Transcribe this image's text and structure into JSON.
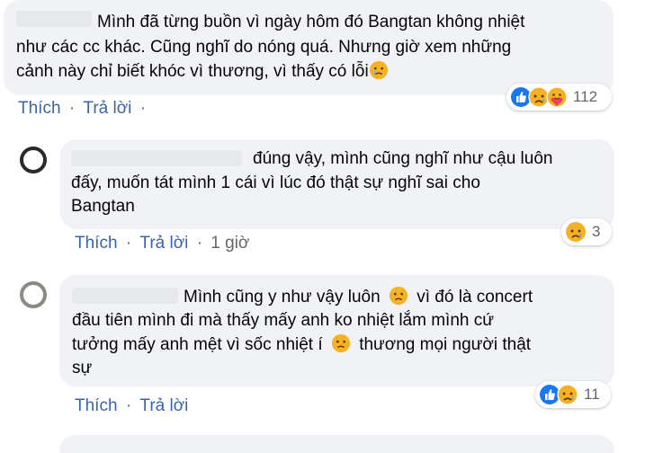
{
  "comments": [
    {
      "lines": [
        "Mình đã từng buồn vì ngày hôm đó Bangtan không nhiệt",
        "như các cc khác. Cũng nghĩ do nóng quá. Nhưng giờ xem những",
        "cảnh này chỉ biết khóc vì thương, vì thấy có lỗi"
      ],
      "like_label": "Thích",
      "reply_label": "Trả lời",
      "sep": "·",
      "reaction_count": "112"
    },
    {
      "lines": [
        "đúng vậy, mình cũng nghĩ như cậu luôn",
        "đấy, muốn tát mình 1 cái vì lúc đó thật sự nghĩ sai cho",
        "Bangtan"
      ],
      "like_label": "Thích",
      "reply_label": "Trả lời",
      "sep": "·",
      "time": "1 giờ",
      "reaction_count": "3"
    },
    {
      "line1_a": "Mình cũng y như vậy luôn",
      "line1_b": "vì đó là concert",
      "line2": "đầu tiên mình đi mà thấy mấy anh ko nhiệt lắm mình cứ",
      "line3_a": "tưởng mấy anh mệt vì sốc nhiệt í",
      "line3_b": "thương mọi người thật",
      "line4": "sự",
      "like_label": "Thích",
      "reply_label": "Trả lời",
      "sep": "·",
      "reaction_count": "11"
    }
  ],
  "colors": {
    "bubble": "#f0f2f5",
    "action_link": "#3a64a8",
    "meta_text": "#65676b",
    "like_blue": "#1877f2",
    "sad_yellow": "#f7b125"
  }
}
